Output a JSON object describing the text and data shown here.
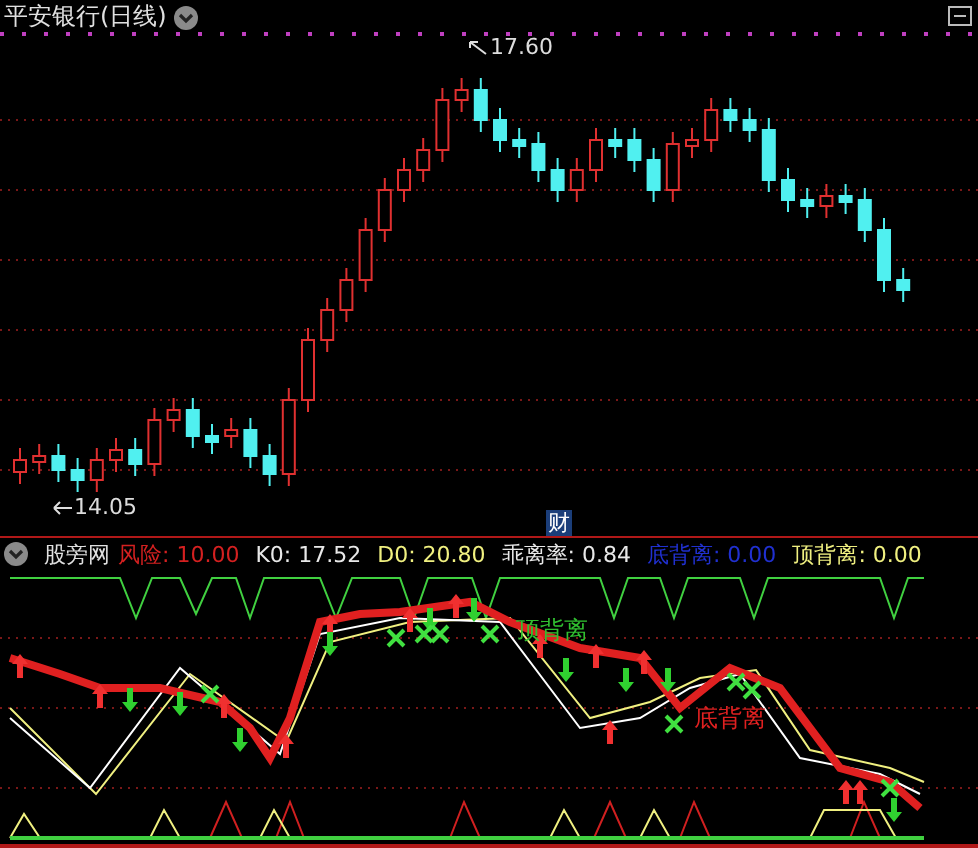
{
  "chart_title": "平安银行(日线)",
  "high_label": "17.60",
  "low_label": "14.05",
  "event_marker": "财",
  "indicator": {
    "name": "股旁网",
    "fields": [
      {
        "text": "风险: 10.00",
        "color": "#d42020"
      },
      {
        "text": "K0: 17.52",
        "color": "#e8e8e8"
      },
      {
        "text": "D0: 20.80",
        "color": "#f0f080"
      },
      {
        "text": "乖离率: 0.84",
        "color": "#e8e8e8"
      },
      {
        "text": "底背离: 0.00",
        "color": "#2030d0"
      },
      {
        "text": "顶背离: 0.00",
        "color": "#f0f080"
      }
    ]
  },
  "annotations": [
    {
      "text": "顶背离",
      "color": "#30c030"
    },
    {
      "text": "底背离",
      "color": "#e02020"
    }
  ]
}
